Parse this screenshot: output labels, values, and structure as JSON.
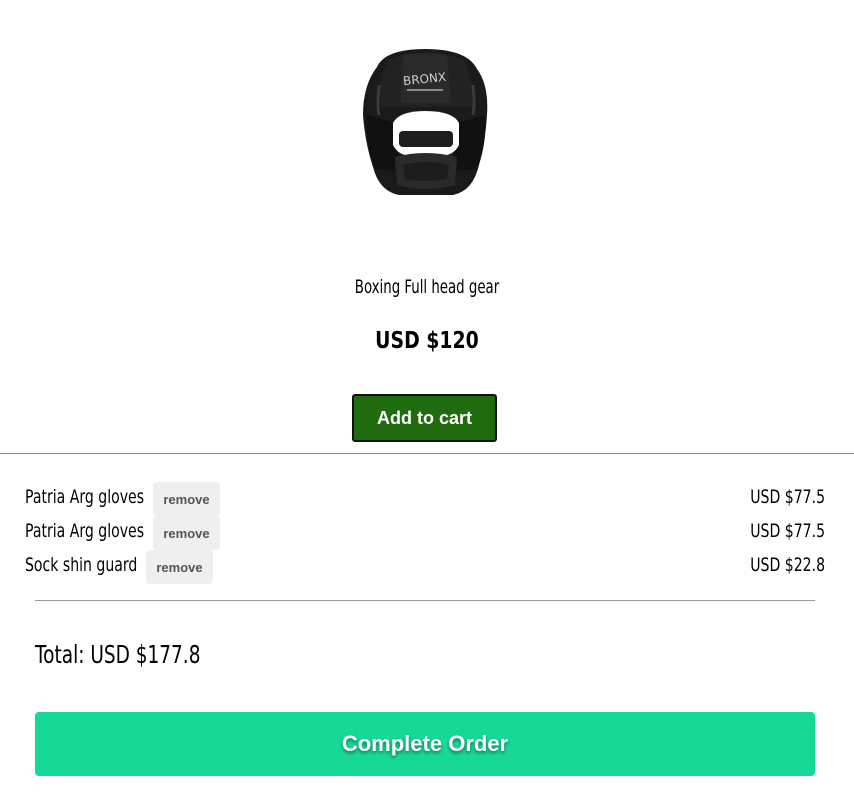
{
  "product": {
    "name": "Boxing Full head gear",
    "price": "USD $120",
    "add_to_cart_label": "Add to cart",
    "image_icon": "boxing-headgear-icon",
    "image_brand_text": "BRONX"
  },
  "cart": {
    "items": [
      {
        "name": "Patria Arg gloves",
        "remove_label": "remove",
        "price": "USD $77.5"
      },
      {
        "name": "Patria Arg gloves",
        "remove_label": "remove",
        "price": "USD $77.5"
      },
      {
        "name": "Sock shin guard",
        "remove_label": "remove",
        "price": "USD $22.8"
      }
    ],
    "total": "Total: USD $177.8",
    "complete_label": "Complete Order"
  },
  "colors": {
    "add_button": "#1f6b0e",
    "complete_button": "#15d994",
    "remove_button_bg": "#efefef"
  }
}
